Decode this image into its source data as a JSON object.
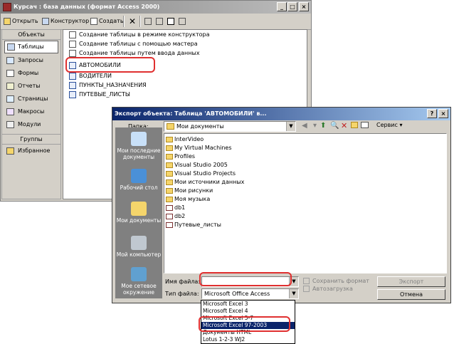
{
  "db_window": {
    "title": "Курсач : база данных (формат Access 2000)",
    "toolbar": {
      "open": "Открыть",
      "design": "Конструктор",
      "create": "Создать"
    },
    "objects_header": "Объекты",
    "objects": [
      "Таблицы",
      "Запросы",
      "Формы",
      "Отчеты",
      "Страницы",
      "Макросы",
      "Модули"
    ],
    "groups_header": "Группы",
    "groups": [
      "Избранное"
    ],
    "items": [
      "Создание таблицы в режиме конструктора",
      "Создание таблицы с помощью мастера",
      "Создание таблицы путем ввода данных",
      "АВТОМОБИЛИ",
      "ВОДИТЕЛИ",
      "ПУНКТЫ_НАЗНАЧЕНИЯ",
      "ПУТЕВЫЕ_ЛИСТЫ"
    ]
  },
  "export_dialog": {
    "title": "Экспорт объекта: Таблица 'АВТОМОБИЛИ' в...",
    "folder_label": "Папка:",
    "folder_value": "Мои документы",
    "service_label": "Сервис",
    "places": [
      "Мои последние документы",
      "Рабочий стол",
      "Мои документы",
      "Мой компьютер",
      "Мое сетевое окружение"
    ],
    "files": [
      "InterVideo",
      "My Virtual Machines",
      "Profiles",
      "Visual Studio 2005",
      "Visual Studio Projects",
      "Мои источники данных",
      "Мои рисунки",
      "Моя музыка",
      "db1",
      "db2",
      "Путевые_листы"
    ],
    "filename_label": "Имя файла:",
    "filename_value": "",
    "filetype_label": "Тип файла:",
    "filetype_value": "Microsoft Office Access",
    "save_format_label": "Сохранить формат",
    "autostart_label": "Автозагрузка",
    "export_button": "Экспорт",
    "cancel_button": "Отмена",
    "filetype_options": [
      "Microsoft Excel 3",
      "Microsoft Excel 4",
      "Microsoft Excel 5-7",
      "Microsoft Excel 97-2003",
      "Документы HTML",
      "Lotus 1-2-3 WJ2"
    ],
    "filetype_selected": "Microsoft Excel 97-2003"
  },
  "colors": {
    "highlight": "#e03030",
    "selection": "#0a246a"
  }
}
